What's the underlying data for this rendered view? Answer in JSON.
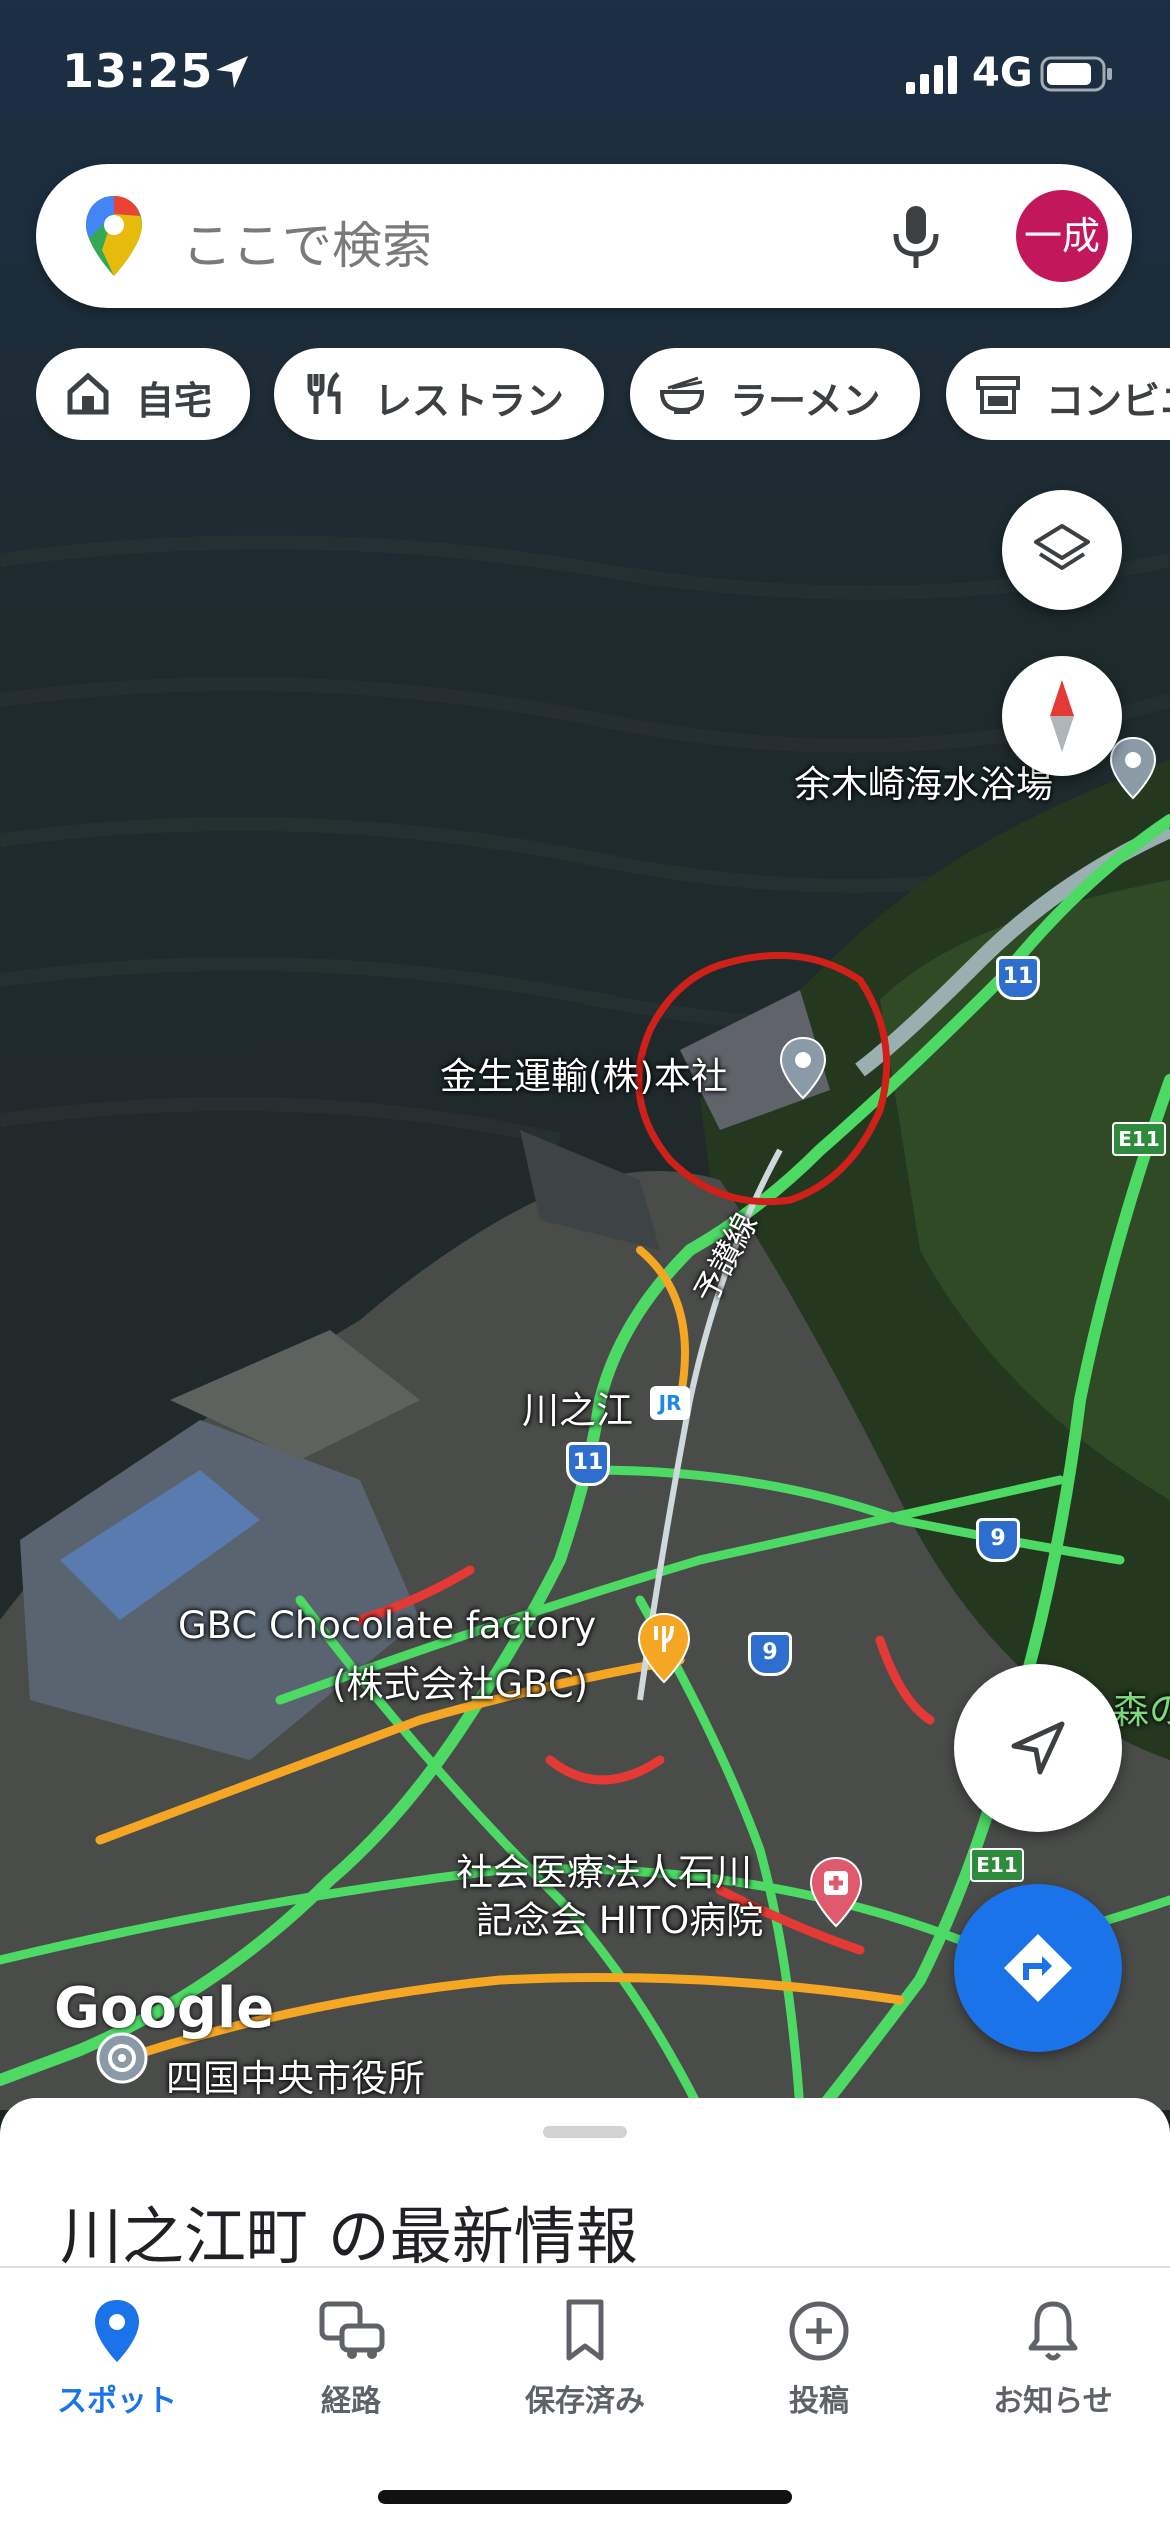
{
  "status_bar": {
    "time": "13:25",
    "network": "4G"
  },
  "search": {
    "placeholder": "ここで検索",
    "avatar_text": "一成"
  },
  "chips": [
    {
      "label": "自宅",
      "icon": "home-icon"
    },
    {
      "label": "レストラン",
      "icon": "restaurant-icon"
    },
    {
      "label": "ラーメン",
      "icon": "ramen-icon"
    },
    {
      "label": "コンビニ",
      "icon": "store-icon"
    }
  ],
  "map": {
    "labels": {
      "beach": "余木崎海水浴場",
      "company": "金生運輸(株)本社",
      "rail_line": "予讃線",
      "station": "川之江",
      "station_badge": "JR",
      "chocolate_1": "GBC Chocolate factory",
      "chocolate_2": "(株式会社GBC)",
      "hospital_1": "社会医療法人石川",
      "hospital_2": "記念会 HITO病院",
      "city_hall": "四国中央市役所",
      "forest": "森の",
      "google": "Google"
    },
    "route_shields": {
      "r11a": "11",
      "r11b": "11",
      "r9a": "9",
      "r9b": "9",
      "e11a": "E11",
      "e11b": "E11"
    },
    "colors": {
      "traffic_green": "#4cd964",
      "traffic_orange": "#f5a623",
      "traffic_red": "#e53935",
      "annotation_circle": "#d0201a"
    }
  },
  "sheet": {
    "title": "川之江町 の最新情報"
  },
  "nav": [
    {
      "label": "スポット",
      "icon": "place-pin-icon",
      "active": true
    },
    {
      "label": "経路",
      "icon": "commute-icon",
      "active": false
    },
    {
      "label": "保存済み",
      "icon": "bookmark-icon",
      "active": false
    },
    {
      "label": "投稿",
      "icon": "add-circle-icon",
      "active": false
    },
    {
      "label": "お知らせ",
      "icon": "bell-icon",
      "active": false
    }
  ]
}
